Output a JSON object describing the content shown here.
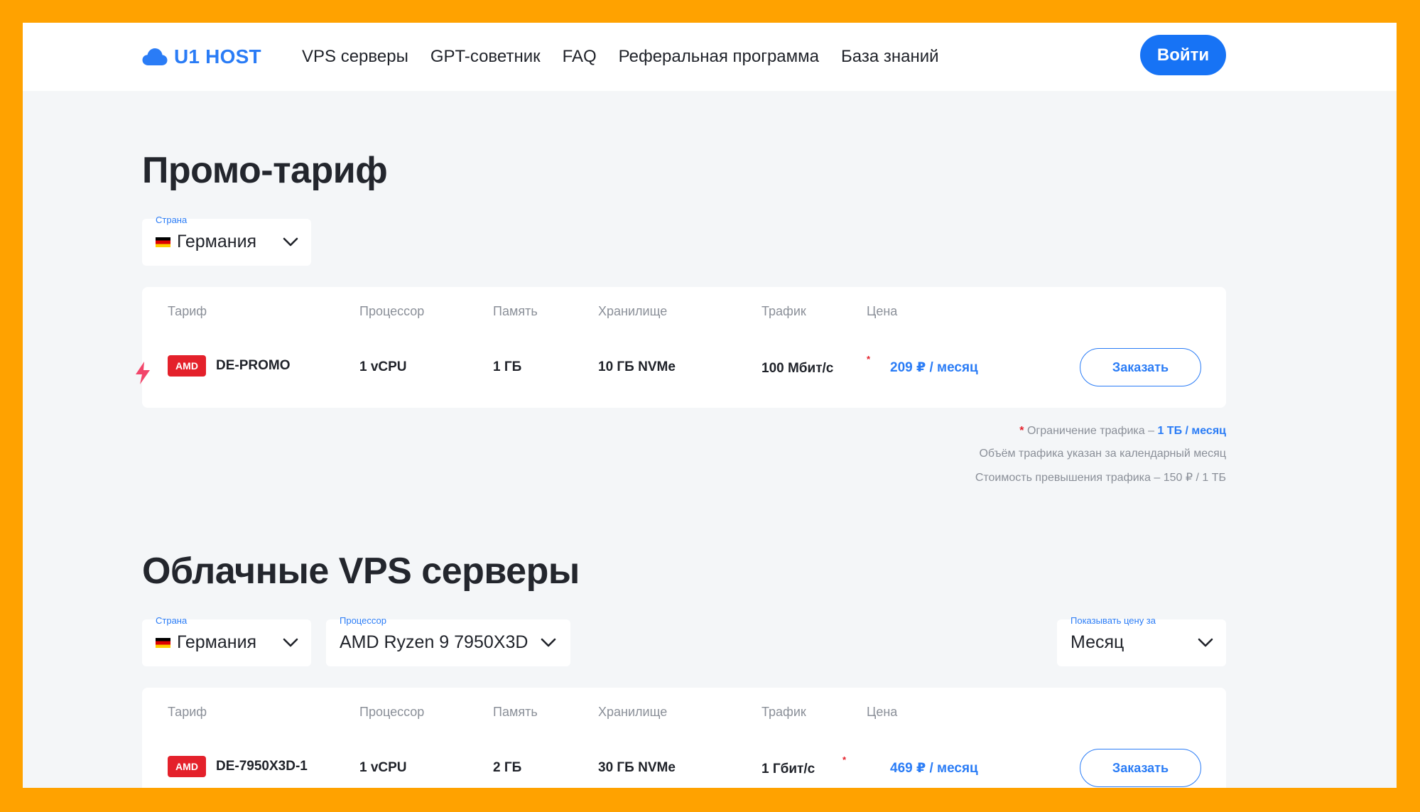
{
  "header": {
    "logo_text": "U1 HOST",
    "nav": [
      "VPS серверы",
      "GPT-советник",
      "FAQ",
      "Реферальная программа",
      "База знаний"
    ],
    "login_label": "Войти"
  },
  "promo": {
    "title": "Промо-тариф",
    "country_filter": {
      "label": "Страна",
      "value": "Германия"
    },
    "columns": [
      "Тариф",
      "Процессор",
      "Память",
      "Хранилище",
      "Трафик",
      "Цена"
    ],
    "row": {
      "badge": "AMD",
      "plan": "DE-PROMO",
      "cpu": "1 vCPU",
      "ram": "1 ГБ",
      "storage": "10 ГБ NVMe",
      "traffic": "100 Мбит/с",
      "traffic_mark": "*",
      "price": "209 ₽ / месяц",
      "order_label": "Заказать"
    },
    "notes": {
      "mark": "*",
      "line1_text": "Ограничение трафика – ",
      "line1_highlight": "1 ТБ / месяц",
      "line2": "Объём трафика указан за календарный месяц",
      "line3": "Стоимость превышения трафика – 150 ₽ / 1 ТБ"
    }
  },
  "cloud": {
    "title": "Облачные VPS серверы",
    "country_filter": {
      "label": "Страна",
      "value": "Германия"
    },
    "cpu_filter": {
      "label": "Процессор",
      "value": "AMD Ryzen 9 7950X3D"
    },
    "period_filter": {
      "label": "Показывать цену за",
      "value": "Месяц"
    },
    "columns": [
      "Тариф",
      "Процессор",
      "Память",
      "Хранилище",
      "Трафик",
      "Цена"
    ],
    "rows": [
      {
        "badge": "AMD",
        "plan": "DE-7950X3D-1",
        "cpu": "1 vCPU",
        "ram": "2 ГБ",
        "storage": "30 ГБ NVMe",
        "traffic": "1 Гбит/с",
        "traffic_mark": "*",
        "price": "469 ₽ / месяц",
        "order_label": "Заказать"
      }
    ]
  },
  "colors": {
    "accent": "#2a7cf6",
    "button_blue": "#1773f5",
    "amd_red": "#e4212b",
    "frame_orange": "#FFA200",
    "bolt_pink": "#f2456a"
  }
}
